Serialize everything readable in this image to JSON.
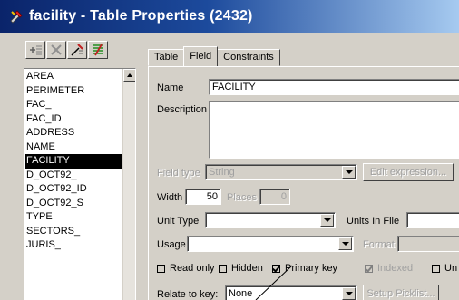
{
  "window": {
    "title": "facility - Table Properties (2432)"
  },
  "toolbar": {
    "icons": [
      "add-field-icon",
      "delete-field-icon",
      "edit-field-icon",
      "properties-icon"
    ]
  },
  "field_list": {
    "items": [
      "AREA",
      "PERIMETER",
      "FAC_",
      "FAC_ID",
      "ADDRESS",
      "NAME",
      "FACILITY",
      "D_OCT92_",
      "D_OCT92_ID",
      "D_OCT92_S",
      "TYPE",
      "SECTORS_",
      "JURIS_"
    ],
    "selected": "FACILITY"
  },
  "tabs": [
    {
      "label": "Table"
    },
    {
      "label": "Field"
    },
    {
      "label": "Constraints"
    }
  ],
  "form": {
    "name_label": "Name",
    "name_value": "FACILITY",
    "description_label": "Description",
    "description_value": "",
    "field_type_label": "Field type",
    "field_type_value": "String",
    "edit_expression_label": "Edit expression...",
    "width_label": "Width",
    "width_value": "50",
    "places_label": "Places",
    "places_value": "0",
    "unit_type_label": "Unit Type",
    "unit_type_value": "",
    "units_in_file_label": "Units In File",
    "units_in_file_value": "",
    "usage_label": "Usage",
    "usage_value": "",
    "format_label": "Format",
    "format_value": "",
    "read_only_label": "Read only",
    "hidden_label": "Hidden",
    "primary_key_label": "Primary key",
    "indexed_label": "Indexed",
    "unique_label": "Un",
    "relate_to_key_label": "Relate to key:",
    "relate_to_key_value": "None",
    "setup_picklist_label": "Setup Picklist..."
  },
  "checkboxes": {
    "read_only": false,
    "hidden": false,
    "primary_key": true,
    "indexed": true,
    "unique": false
  }
}
